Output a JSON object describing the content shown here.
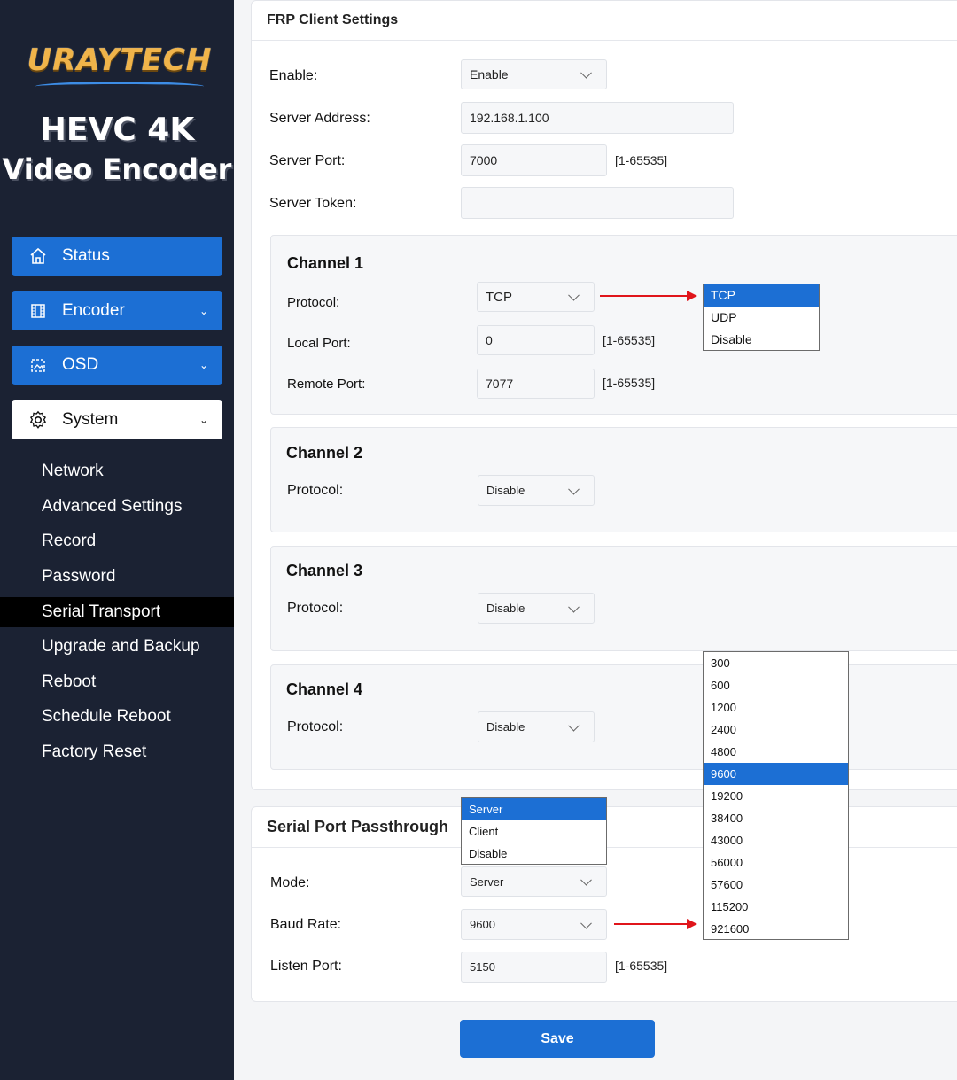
{
  "brand": {
    "logo": "URAYTECH",
    "product_line1": "HEVC 4K",
    "product_line2": "Video Encoder"
  },
  "nav": {
    "status": "Status",
    "encoder": "Encoder",
    "osd": "OSD",
    "system": "System",
    "system_sub": [
      "Network",
      "Advanced Settings",
      "Record",
      "Password",
      "Serial Transport",
      "Upgrade and Backup",
      "Reboot",
      "Schedule Reboot",
      "Factory Reset"
    ],
    "active_sub": "Serial Transport"
  },
  "frp": {
    "title": "FRP Client Settings",
    "enable_label": "Enable:",
    "enable_value": "Enable",
    "server_address_label": "Server Address:",
    "server_address_value": "192.168.1.100",
    "server_port_label": "Server Port:",
    "server_port_value": "7000",
    "server_port_hint": "[1-65535]",
    "server_token_label": "Server Token:",
    "server_token_value": "",
    "channels": [
      {
        "title": "Channel 1",
        "protocol_label": "Protocol:",
        "protocol_value": "TCP",
        "local_port_label": "Local Port:",
        "local_port_value": "0",
        "local_port_hint": "[1-65535]",
        "remote_port_label": "Remote Port:",
        "remote_port_value": "7077",
        "remote_port_hint": "[1-65535]"
      },
      {
        "title": "Channel 2",
        "protocol_label": "Protocol:",
        "protocol_value": "Disable"
      },
      {
        "title": "Channel 3",
        "protocol_label": "Protocol:",
        "protocol_value": "Disable"
      },
      {
        "title": "Channel 4",
        "protocol_label": "Protocol:",
        "protocol_value": "Disable"
      }
    ],
    "protocol_options": [
      "TCP",
      "UDP",
      "Disable"
    ],
    "protocol_selected": "TCP"
  },
  "serial": {
    "title": "Serial Port Passthrough",
    "mode_label": "Mode:",
    "mode_value": "Server",
    "mode_options": [
      "Server",
      "Client",
      "Disable"
    ],
    "baud_label": "Baud Rate:",
    "baud_value": "9600",
    "baud_options": [
      "300",
      "600",
      "1200",
      "2400",
      "4800",
      "9600",
      "19200",
      "38400",
      "43000",
      "56000",
      "57600",
      "115200",
      "921600"
    ],
    "listen_port_label": "Listen Port:",
    "listen_port_value": "5150",
    "listen_port_hint": "[1-65535]"
  },
  "save_label": "Save",
  "colors": {
    "sidebar": "#1b2233",
    "accent": "#1c6fd4",
    "arrow": "#e0151b"
  }
}
